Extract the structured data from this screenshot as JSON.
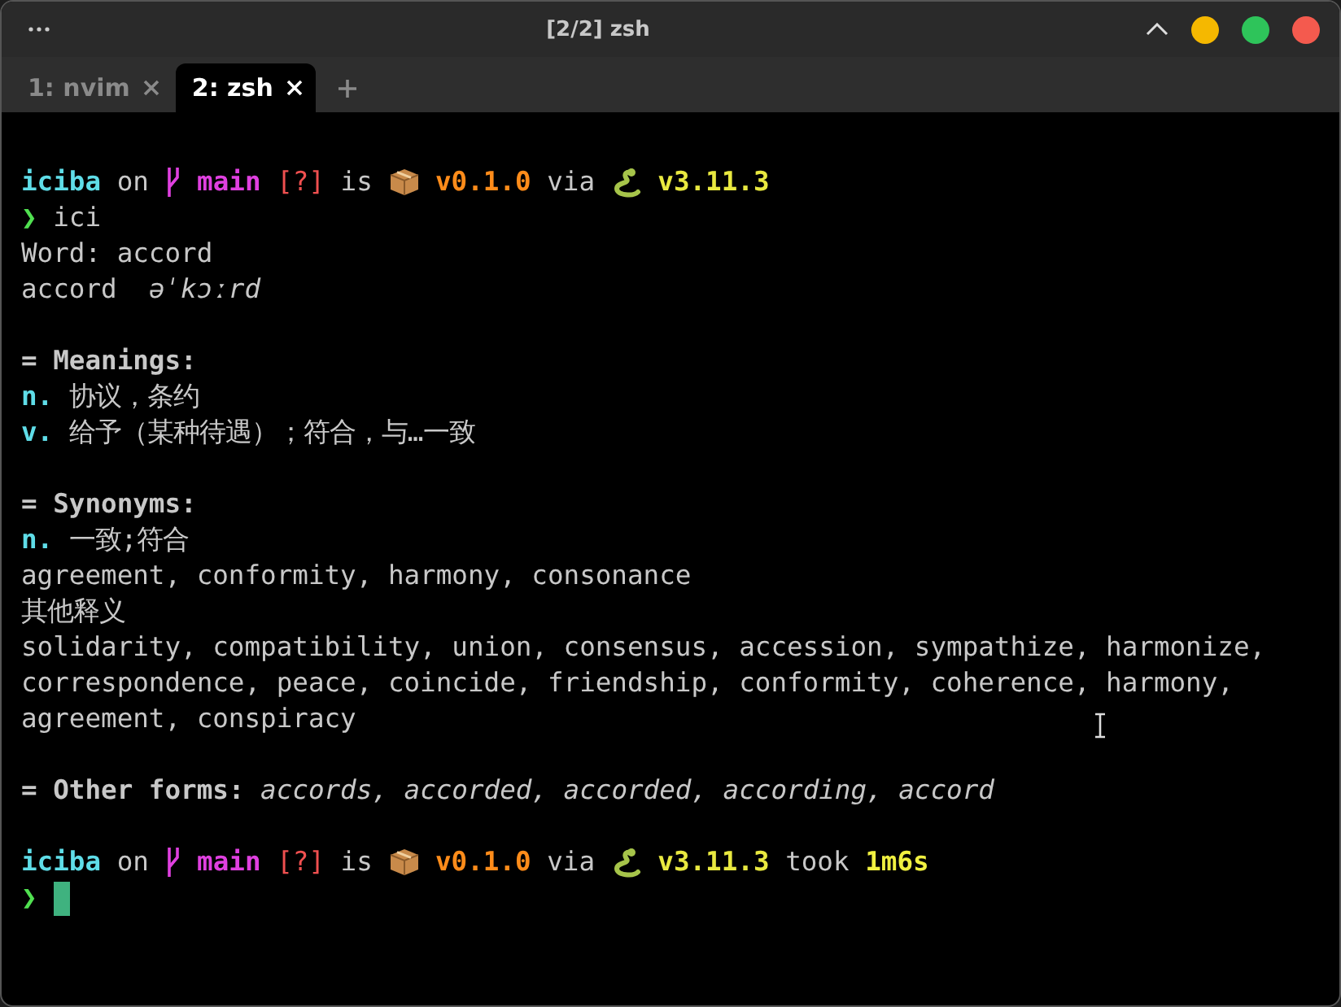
{
  "window": {
    "title": "[2/2] zsh"
  },
  "tabs": [
    {
      "label": "1: nvim",
      "selected": false
    },
    {
      "label": "2: zsh",
      "selected": true
    }
  ],
  "terminal": {
    "lines": [
      {
        "kind": "blank"
      },
      {
        "kind": "text",
        "segments": [
          {
            "kind": "dir",
            "text": "iciba"
          },
          {
            "kind": "plain",
            "text": " on "
          },
          {
            "kind": "branch-icon"
          },
          {
            "kind": "branch",
            "text": " main "
          },
          {
            "kind": "status",
            "text": "[?]"
          },
          {
            "kind": "plain",
            "text": " is "
          },
          {
            "kind": "package-icon"
          },
          {
            "kind": "version",
            "text": " v0.1.0"
          },
          {
            "kind": "plain",
            "text": " via "
          },
          {
            "kind": "snake-icon"
          },
          {
            "kind": "lang",
            "text": " v3.11.3"
          }
        ]
      },
      {
        "kind": "text",
        "segments": [
          {
            "kind": "prompt",
            "text": "❯"
          },
          {
            "kind": "plain",
            "text": " ici"
          }
        ]
      },
      {
        "kind": "text",
        "segments": [
          {
            "kind": "plain",
            "text": "Word: accord"
          }
        ]
      },
      {
        "kind": "text",
        "segments": [
          {
            "kind": "plain",
            "text": "accord  "
          },
          {
            "kind": "italic",
            "text": "əˈkɔːrd"
          }
        ]
      },
      {
        "kind": "blank"
      },
      {
        "kind": "text",
        "segments": [
          {
            "kind": "heading",
            "text": "= Meanings:"
          }
        ]
      },
      {
        "kind": "text",
        "segments": [
          {
            "kind": "pos",
            "text": "n."
          },
          {
            "kind": "plain",
            "text": " 协议，条约"
          }
        ]
      },
      {
        "kind": "text",
        "segments": [
          {
            "kind": "pos",
            "text": "v."
          },
          {
            "kind": "plain",
            "text": " 给予（某种待遇）；符合，与…一致"
          }
        ]
      },
      {
        "kind": "blank"
      },
      {
        "kind": "text",
        "segments": [
          {
            "kind": "heading",
            "text": "= Synonyms:"
          }
        ]
      },
      {
        "kind": "text",
        "segments": [
          {
            "kind": "pos",
            "text": "n."
          },
          {
            "kind": "plain",
            "text": " 一致;符合"
          }
        ]
      },
      {
        "kind": "text",
        "segments": [
          {
            "kind": "plain",
            "text": "agreement, conformity, harmony, consonance"
          }
        ]
      },
      {
        "kind": "text",
        "segments": [
          {
            "kind": "plain",
            "text": "其他释义"
          }
        ]
      },
      {
        "kind": "text",
        "segments": [
          {
            "kind": "plain",
            "text": "solidarity, compatibility, union, consensus, accession, sympathize, harmonize,"
          }
        ]
      },
      {
        "kind": "text",
        "segments": [
          {
            "kind": "plain",
            "text": "correspondence, peace, coincide, friendship, conformity, coherence, harmony,"
          }
        ]
      },
      {
        "kind": "text",
        "segments": [
          {
            "kind": "plain",
            "text": "agreement, conspiracy"
          }
        ]
      },
      {
        "kind": "blank"
      },
      {
        "kind": "text",
        "segments": [
          {
            "kind": "heading",
            "text": "= Other forms: "
          },
          {
            "kind": "italic",
            "text": "accords, accorded, accorded, according, accord"
          }
        ]
      },
      {
        "kind": "blank"
      },
      {
        "kind": "text",
        "segments": [
          {
            "kind": "dir",
            "text": "iciba"
          },
          {
            "kind": "plain",
            "text": " on "
          },
          {
            "kind": "branch-icon"
          },
          {
            "kind": "branch",
            "text": " main "
          },
          {
            "kind": "status",
            "text": "[?]"
          },
          {
            "kind": "plain",
            "text": " is "
          },
          {
            "kind": "package-icon"
          },
          {
            "kind": "version",
            "text": " v0.1.0"
          },
          {
            "kind": "plain",
            "text": " via "
          },
          {
            "kind": "snake-icon"
          },
          {
            "kind": "lang",
            "text": " v3.11.3"
          },
          {
            "kind": "plain",
            "text": " took "
          },
          {
            "kind": "took",
            "text": "1m6s"
          }
        ]
      },
      {
        "kind": "text",
        "segments": [
          {
            "kind": "prompt",
            "text": "❯"
          },
          {
            "kind": "cursor"
          }
        ]
      }
    ]
  }
}
